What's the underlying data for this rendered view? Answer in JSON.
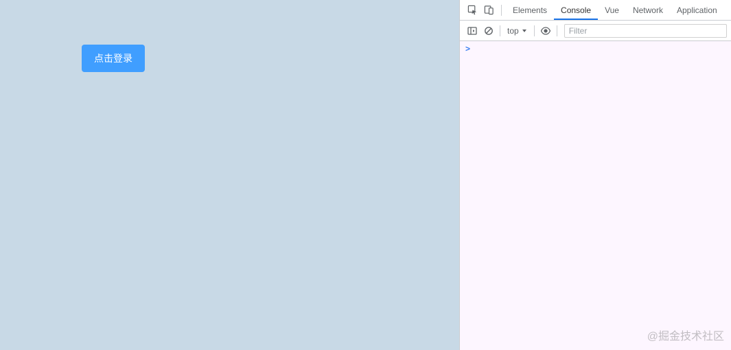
{
  "app": {
    "login_button_label": "点击登录"
  },
  "devtools": {
    "tabs": {
      "elements": "Elements",
      "console": "Console",
      "vue": "Vue",
      "network": "Network",
      "application": "Application"
    },
    "toolbar": {
      "context_label": "top",
      "filter_placeholder": "Filter"
    },
    "console_prompt": ">"
  },
  "watermark": "@掘金技术社区"
}
